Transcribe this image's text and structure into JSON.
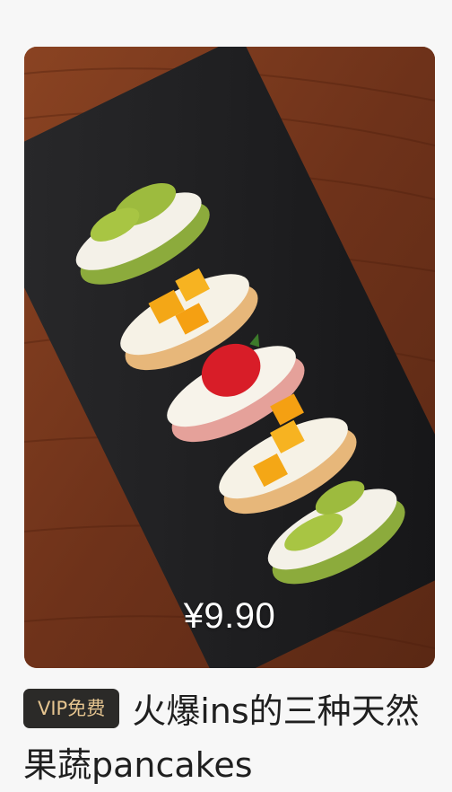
{
  "product": {
    "price": "¥9.90",
    "badge": "VIP免费",
    "title": "火爆ins的三种天然果蔬pancakes"
  },
  "colors": {
    "badge_bg": "#2b2a28",
    "badge_text": "#e6c590",
    "title_text": "#1f1f1f",
    "page_bg": "#f7f7f7"
  }
}
